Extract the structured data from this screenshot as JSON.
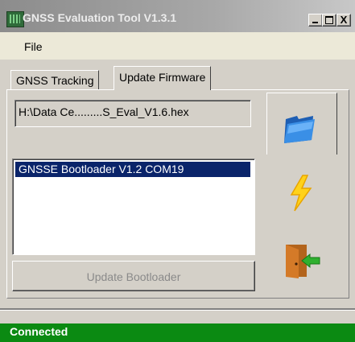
{
  "window": {
    "title": "GNSS Evaluation Tool V1.3.1",
    "controls": {
      "minimize": "_",
      "maximize": "□",
      "close": "X"
    }
  },
  "menu": {
    "file_label": "File"
  },
  "tabs": [
    {
      "label": "GNSS Tracking",
      "active": false
    },
    {
      "label": "Update Firmware",
      "active": true
    }
  ],
  "firmware": {
    "file_path": "H:\\Data Ce.........S_Eval_V1.6.hex",
    "devices": [
      "GNSSE Bootloader V1.2  COM19"
    ],
    "selected_device": "GNSSE Bootloader V1.2  COM19",
    "update_button_label": "Update Bootloader",
    "update_button_enabled": false
  },
  "toolbar": {
    "icons": [
      "folder-open-icon",
      "lightning-icon",
      "exit-door-icon"
    ]
  },
  "status": {
    "text": "Connected",
    "color": "#0b8a12"
  },
  "colors": {
    "selection": "#0a246a",
    "titlebar_text": "#ececec"
  }
}
